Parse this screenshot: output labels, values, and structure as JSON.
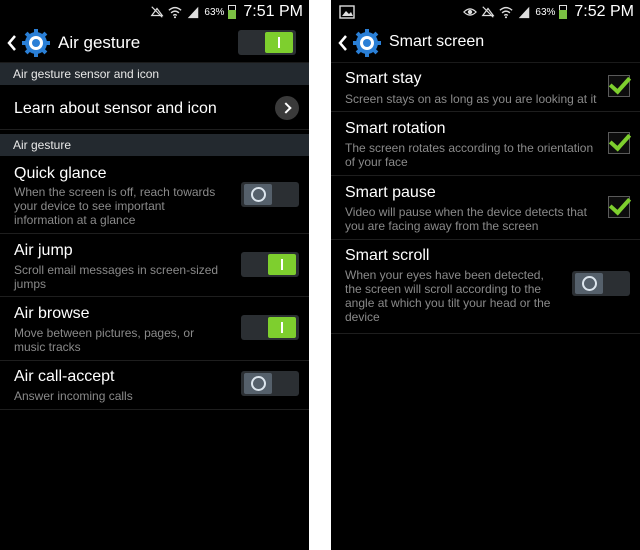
{
  "left": {
    "status": {
      "battery": "63%",
      "time": "7:51 PM"
    },
    "header": {
      "title": "Air gesture",
      "master_on": true
    },
    "sections": [
      {
        "header": "Air gesture sensor and icon"
      },
      {
        "header": "Air gesture"
      }
    ],
    "learn_row": {
      "title": "Learn about sensor and icon"
    },
    "items": [
      {
        "title": "Quick glance",
        "subtitle": "When the screen is off, reach towards your device to see important information at a glance",
        "on": false
      },
      {
        "title": "Air jump",
        "subtitle": "Scroll email messages in screen-sized jumps",
        "on": true
      },
      {
        "title": "Air browse",
        "subtitle": "Move between pictures, pages, or music tracks",
        "on": true
      },
      {
        "title": "Air call-accept",
        "subtitle": "Answer incoming calls",
        "on": false
      }
    ]
  },
  "right": {
    "status": {
      "battery": "63%",
      "time": "7:52 PM"
    },
    "header": {
      "title": "Smart screen"
    },
    "items": [
      {
        "title": "Smart stay",
        "subtitle": "Screen stays on as long as you are looking at it",
        "checked": true
      },
      {
        "title": "Smart rotation",
        "subtitle": "The screen rotates according to the orientation of your face",
        "checked": true
      },
      {
        "title": "Smart pause",
        "subtitle": "Video will pause when the device detects that you are facing away from the screen",
        "checked": true
      },
      {
        "title": "Smart scroll",
        "subtitle": "When your eyes have been detected, the screen will scroll according to the angle at which you tilt your head or the device",
        "on": false
      }
    ]
  },
  "colors": {
    "accent_green": "#7ecf2e",
    "section_bg": "#23292f",
    "gear_blue": "#2a7fd6"
  }
}
